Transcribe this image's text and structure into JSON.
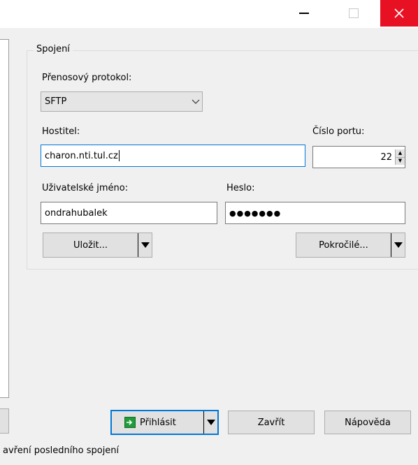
{
  "window": {
    "minimize_icon": "minimize-icon",
    "maximize_icon": "maximize-icon",
    "close_icon": "close-icon",
    "close_color": "#e81123"
  },
  "session": {
    "group_title": "Spojení",
    "protocol": {
      "label": "Přenosový protokol:",
      "value": "SFTP"
    },
    "host": {
      "label": "Hostitel:",
      "value": "charon.nti.tul.cz"
    },
    "port": {
      "label": "Číslo portu:",
      "value": "22"
    },
    "username": {
      "label": "Uživatelské jméno:",
      "value": "ondrahubalek"
    },
    "password": {
      "label": "Heslo:",
      "value": "●●●●●●●"
    },
    "save_button": "Uložit...",
    "advanced_button": "Pokročilé..."
  },
  "footer": {
    "login_button": "Přihlásit",
    "close_button": "Zavřít",
    "help_button": "Nápověda",
    "status_text": "avření posledního spojení"
  },
  "colors": {
    "accent": "#0078d7",
    "login_icon": "#1f9d3a"
  }
}
